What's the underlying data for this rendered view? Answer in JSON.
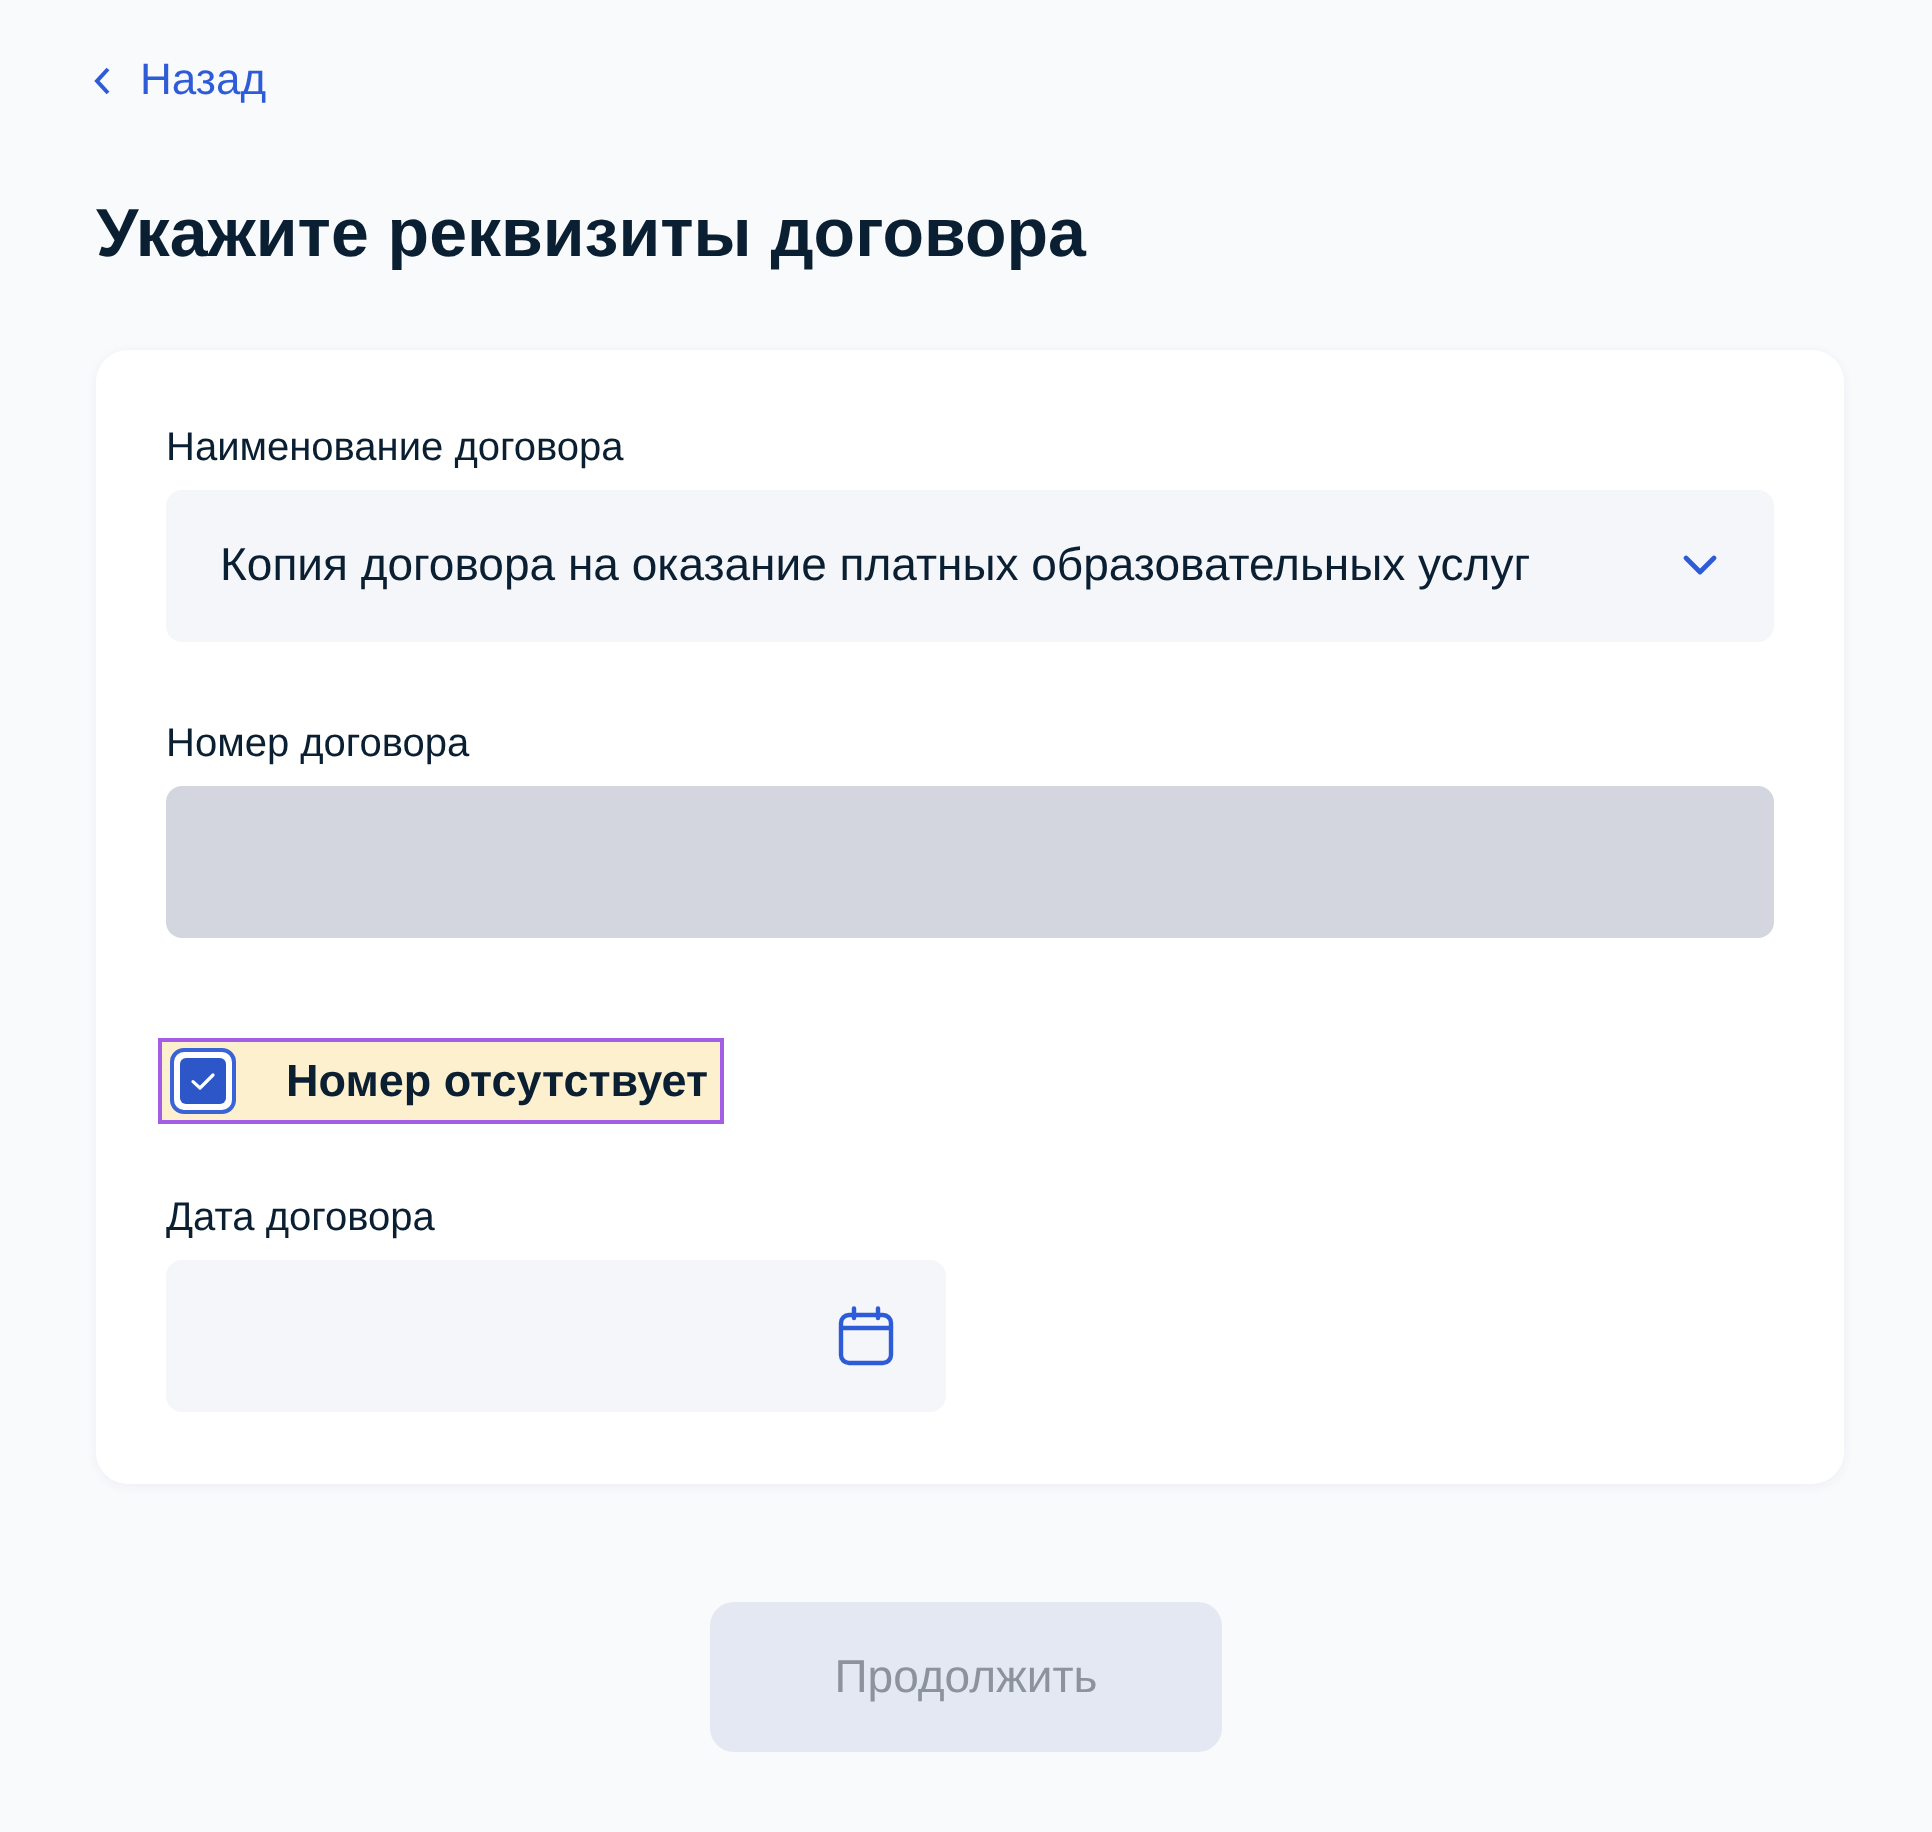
{
  "back_link": {
    "label": "Назад"
  },
  "title": "Укажите реквизиты договора",
  "form": {
    "fields": [
      {
        "kind": "select",
        "label": "Наименование договора",
        "value": "Копия договора на оказание платных образовательных услуг",
        "disabled": false
      },
      {
        "kind": "text",
        "label": "Номер договора",
        "disabled": true
      },
      {
        "kind": "checkbox",
        "label": "Номер отсутствует",
        "checked": true,
        "highlighted": true
      },
      {
        "kind": "date",
        "label": "Дата договора",
        "disabled": false
      }
    ]
  },
  "continue_button": {
    "label": "Продолжить",
    "disabled": true
  }
}
